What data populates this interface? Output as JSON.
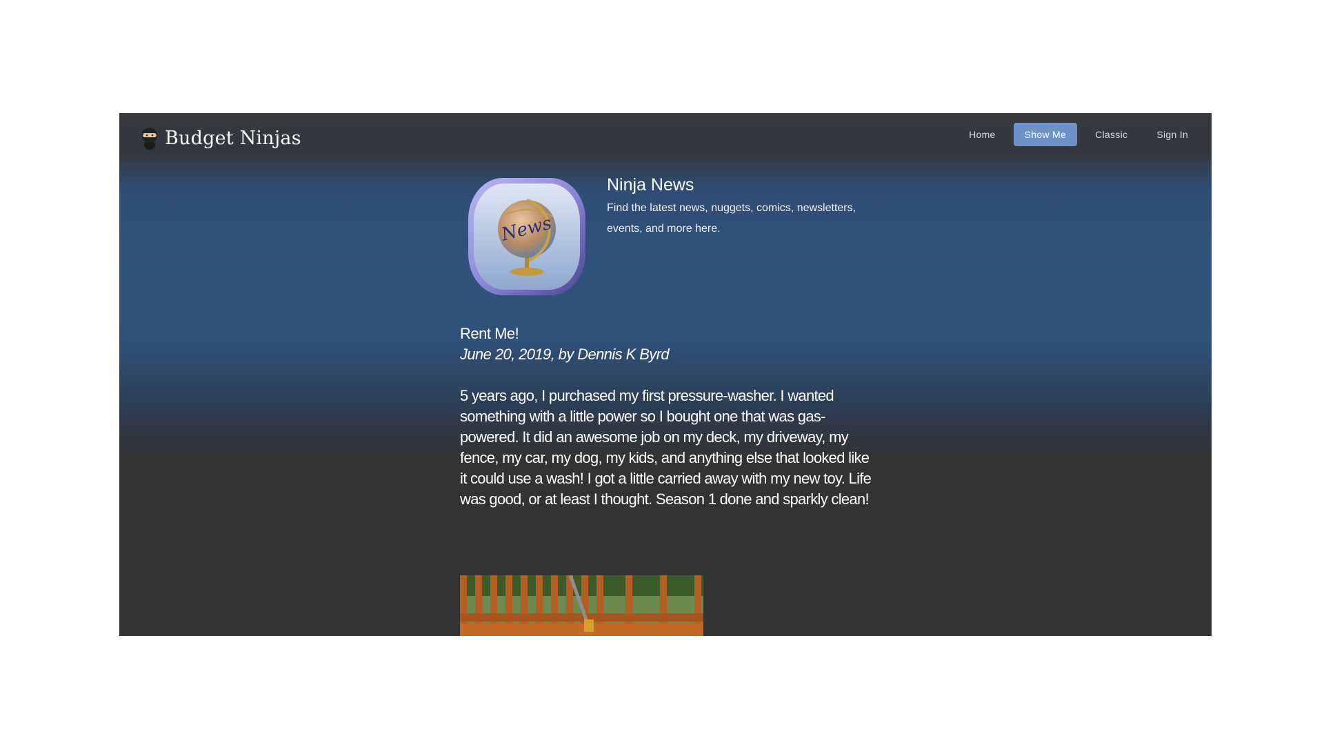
{
  "brand": {
    "name": "Budget Ninjas",
    "icon": "ninja-icon"
  },
  "nav": {
    "items": [
      {
        "label": "Home",
        "active": false
      },
      {
        "label": "Show Me",
        "active": true
      },
      {
        "label": "Classic",
        "active": false
      },
      {
        "label": "Sign In",
        "active": false
      }
    ]
  },
  "news_header": {
    "icon": "news-globe-icon",
    "icon_text": "News",
    "title": "Ninja News",
    "description": "Find the latest news, nuggets, comics, newsletters, events, and more here."
  },
  "article": {
    "title": "Rent Me!",
    "byline": "June 20, 2019, by Dennis K Byrd",
    "body": "5 years ago, I purchased my first pressure-washer. I wanted something with a little power so I bought one that was gas-powered. It did an awesome job on my deck, my driveway, my fence, my car, my dog, my kids, and anything else that looked like it could use a wash! I got a little carried away with my new toy. Life was good, or at least I thought. Season 1 done and sparkly clean!"
  },
  "colors": {
    "accent": "#6f93c9",
    "text": "#ffffff"
  }
}
